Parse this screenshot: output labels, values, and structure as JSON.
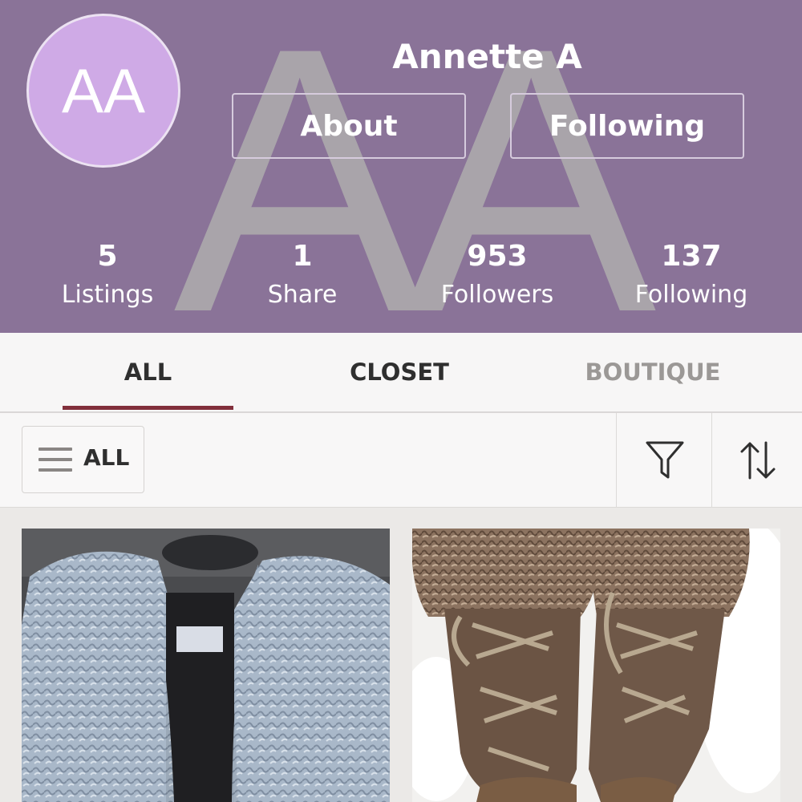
{
  "profile": {
    "initials": "AA",
    "name": "Annette A",
    "about_label": "About",
    "following_button_label": "Following"
  },
  "stats": [
    {
      "value": "5",
      "label": "Listings"
    },
    {
      "value": "1",
      "label": "Share"
    },
    {
      "value": "953",
      "label": "Followers"
    },
    {
      "value": "137",
      "label": "Following"
    }
  ],
  "tabs": [
    {
      "label": "ALL",
      "active": true
    },
    {
      "label": "CLOSET",
      "active": false
    },
    {
      "label": "BOUTIQUE",
      "active": false
    }
  ],
  "toolbar": {
    "category_label": "ALL",
    "filter_icon": "filter-icon",
    "sort_icon": "sort-icon"
  },
  "listings": [
    {
      "image": "grey-faux-fur-jacket"
    },
    {
      "image": "brown-lace-up-fur-boots"
    }
  ],
  "colors": {
    "header_bg": "#8a7398",
    "avatar_bg": "#cfaae6",
    "active_tab_underline": "#822f3b"
  }
}
